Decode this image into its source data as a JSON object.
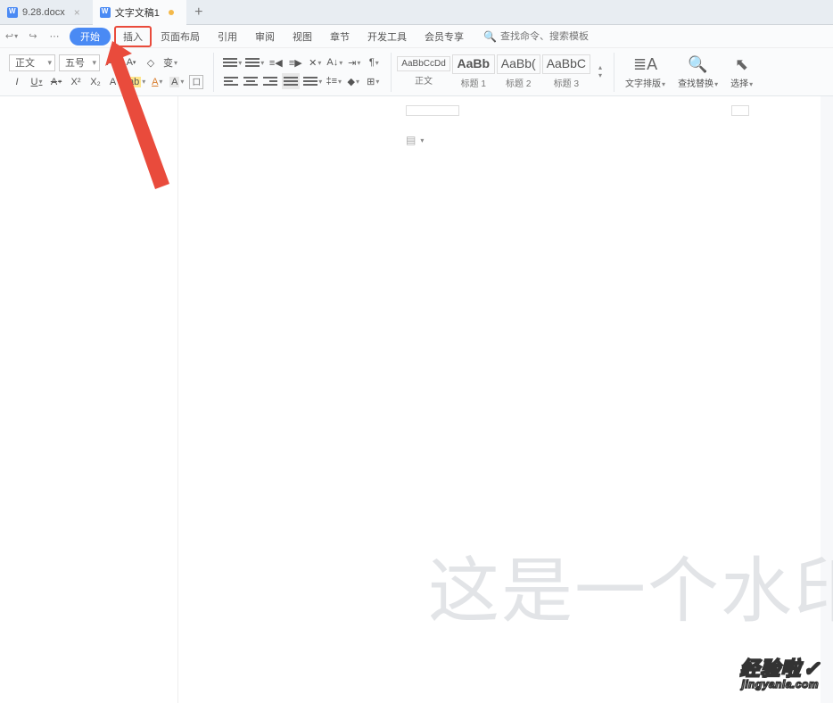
{
  "tabs": {
    "items": [
      {
        "label": "9.28.docx",
        "active": false,
        "dirty": false
      },
      {
        "label": "文字文稿1",
        "active": true,
        "dirty": true
      }
    ]
  },
  "menu": {
    "start": "开始",
    "items": [
      "插入",
      "页面布局",
      "引用",
      "审阅",
      "视图",
      "章节",
      "开发工具",
      "会员专享"
    ],
    "highlight_index": 0,
    "search_placeholder": "查找命令、搜索模板"
  },
  "ribbon": {
    "font_name": "正文",
    "font_size": "五号",
    "styles": [
      {
        "preview": "AaBbCcDd",
        "label": "正文"
      },
      {
        "preview": "AaBb",
        "label": "标题 1"
      },
      {
        "preview": "AaBb(",
        "label": "标题 2"
      },
      {
        "preview": "AaBbC",
        "label": "标题 3"
      }
    ],
    "text_layout": "文字排版",
    "find_replace": "查找替换",
    "select": "选择"
  },
  "document": {
    "watermark_text": "这是一个水印"
  },
  "branding": {
    "line1": "经验啦",
    "line2": "jingyanla.com"
  }
}
